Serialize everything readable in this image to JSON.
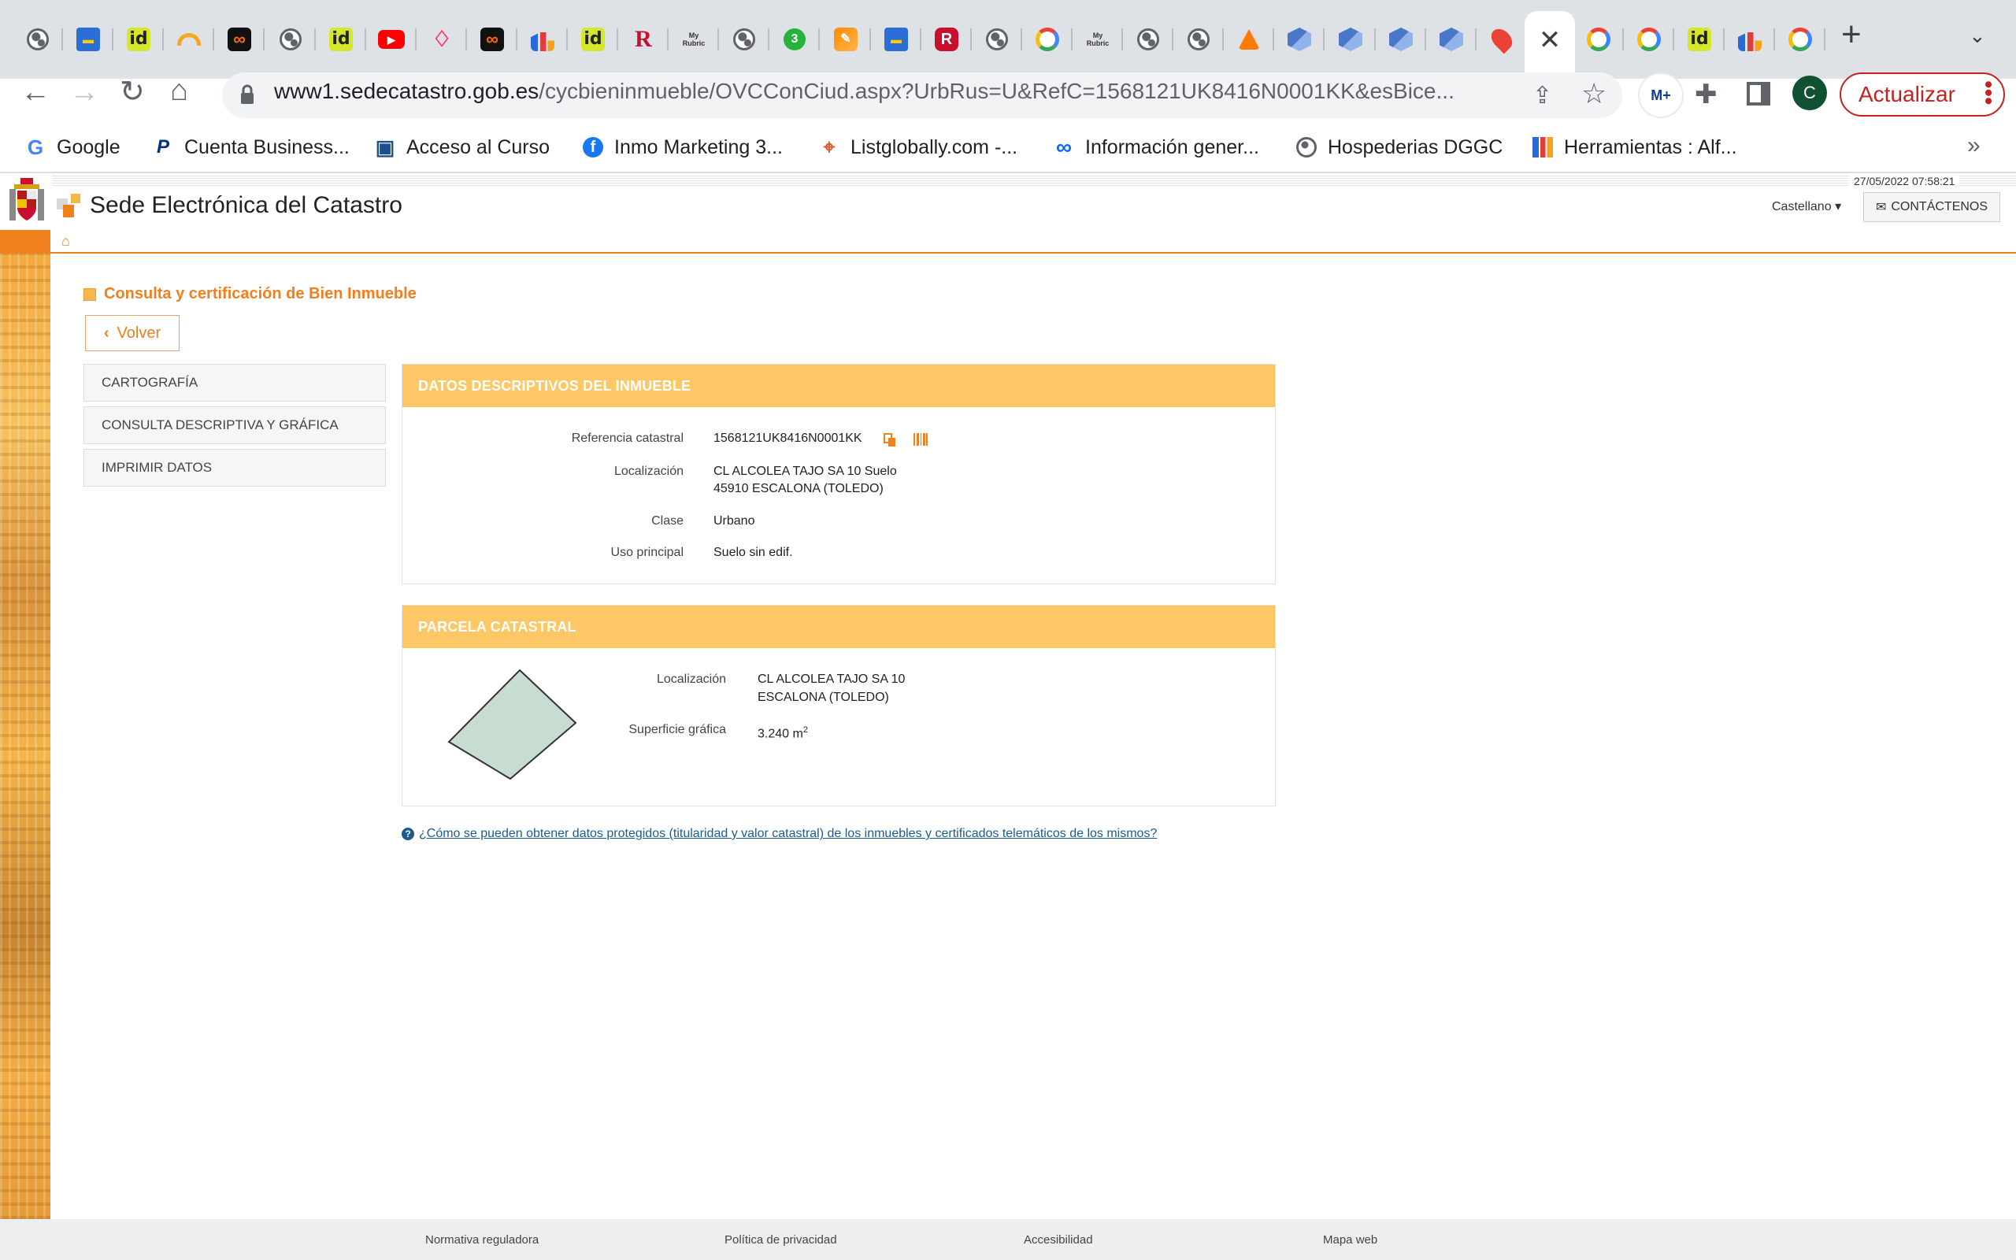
{
  "browser": {
    "tabs": [
      {
        "icon": "globe-icon"
      },
      {
        "icon": "truck-icon"
      },
      {
        "icon": "id-icon",
        "text": "id"
      },
      {
        "icon": "rainbow-icon"
      },
      {
        "icon": "infinity-icon",
        "text": "∞"
      },
      {
        "icon": "globe-icon"
      },
      {
        "icon": "id-icon",
        "text": "id"
      },
      {
        "icon": "youtube-icon",
        "text": "▶"
      },
      {
        "icon": "airbnb-icon",
        "text": "♢"
      },
      {
        "icon": "infinity-icon",
        "text": "∞"
      },
      {
        "icon": "bars-icon"
      },
      {
        "icon": "id-icon",
        "text": "id"
      },
      {
        "icon": "r-icon",
        "text": "R"
      },
      {
        "icon": "myrubric-icon",
        "text": "My Rubric"
      },
      {
        "icon": "globe-icon"
      },
      {
        "icon": "three-icon",
        "text": "3"
      },
      {
        "icon": "doc-icon",
        "text": "✎"
      },
      {
        "icon": "truck-icon"
      },
      {
        "icon": "r-red-icon",
        "text": "R"
      },
      {
        "icon": "globe-icon"
      },
      {
        "icon": "google-icon"
      },
      {
        "icon": "myrubric-icon",
        "text": "My Rubric"
      },
      {
        "icon": "globe-icon"
      },
      {
        "icon": "globe-icon"
      },
      {
        "icon": "triangle-icon"
      },
      {
        "icon": "cube-icon"
      },
      {
        "icon": "cube-icon"
      },
      {
        "icon": "cube-icon"
      },
      {
        "icon": "cube-icon"
      },
      {
        "icon": "maps-icon"
      }
    ],
    "tabs_after": [
      {
        "icon": "google-icon"
      },
      {
        "icon": "google-icon"
      },
      {
        "icon": "id-icon",
        "text": "id"
      },
      {
        "icon": "bars-icon"
      },
      {
        "icon": "google-icon"
      }
    ],
    "close_glyph": "✕",
    "newtab_glyph": "+",
    "tabsearch_glyph": "⌄",
    "url_host": "www1.sedecatastro.gob.es",
    "url_path": "/cycbieninmueble/OVCConCiud.aspx?UrbRus=U&RefC=1568121UK8416N0001KK&esBice...",
    "avatar_letter": "C",
    "update_label": "Actualizar",
    "bookmarks": [
      {
        "label": "Google",
        "icon": "google-icon"
      },
      {
        "label": "Cuenta Business...",
        "icon": "paypal-icon"
      },
      {
        "label": "Acceso al Curso",
        "icon": "course-icon"
      },
      {
        "label": "Inmo Marketing 3...",
        "icon": "facebook-icon"
      },
      {
        "label": "Listglobally.com -...",
        "icon": "pin-icon"
      },
      {
        "label": "Información gener...",
        "icon": "meta-icon"
      },
      {
        "label": "Hospederias DGGC",
        "icon": "globe-icon"
      },
      {
        "label": "Herramientas : Alf...",
        "icon": "bars-icon"
      }
    ],
    "bookmarks_more": "»"
  },
  "site": {
    "datetime": "27/05/2022  07:58:21",
    "title": "Sede Electrónica del Catastro",
    "language": "Castellano",
    "contact": "CONTÁCTENOS"
  },
  "page": {
    "section_title": "Consulta y certificación de Bien Inmueble",
    "back_label": "Volver",
    "side_menu": [
      "CARTOGRAFÍA",
      "CONSULTA DESCRIPTIVA Y GRÁFICA",
      "IMPRIMIR DATOS"
    ],
    "descriptive": {
      "header": "DATOS DESCRIPTIVOS DEL INMUEBLE",
      "ref_label": "Referencia catastral",
      "ref_value": "1568121UK8416N0001KK",
      "loc_label": "Localización",
      "loc_line1": "CL ALCOLEA TAJO SA 10 Suelo",
      "loc_line2": "45910 ESCALONA (TOLEDO)",
      "class_label": "Clase",
      "class_value": "Urbano",
      "use_label": "Uso principal",
      "use_value": "Suelo sin edif."
    },
    "parcel": {
      "header": "PARCELA CATASTRAL",
      "loc_label": "Localización",
      "loc_line1": "CL ALCOLEA TAJO SA 10",
      "loc_line2": "ESCALONA (TOLEDO)",
      "area_label": "Superficie gráfica",
      "area_value": "3.240 m",
      "area_sup": "2",
      "shape_fill": "#c8ddd2"
    },
    "help_text": "¿Cómo se pueden obtener datos protegidos (titularidad y valor catastral) de los inmuebles y certificados telemáticos de los mismos?"
  },
  "footer": {
    "links": [
      "Normativa reguladora",
      "Política de privacidad",
      "Accesibilidad",
      "Mapa web"
    ]
  },
  "colors": {
    "accent": "#f07f1e",
    "panel_header": "#fdc766",
    "link": "#1a5c8f"
  }
}
